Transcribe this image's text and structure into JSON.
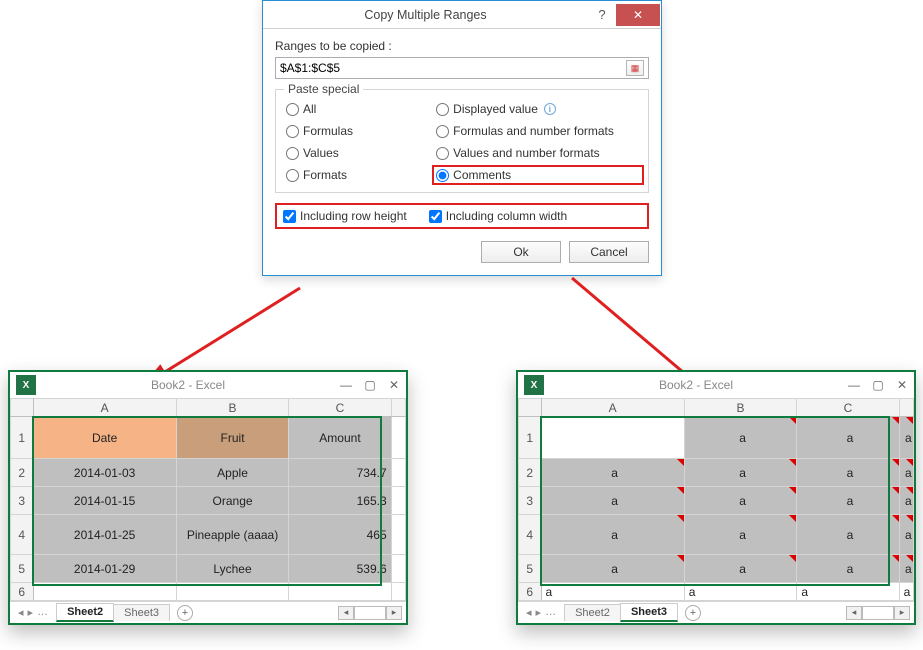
{
  "dialog": {
    "title": "Copy Multiple Ranges",
    "help_char": "?",
    "close_char": "✕",
    "ranges_label": "Ranges to be copied :",
    "ranges_value": "$A$1:$C$5",
    "fieldset_legend": "Paste special",
    "options": {
      "all": "All",
      "displayed_value": "Displayed value",
      "formulas": "Formulas",
      "formulas_num_fmt": "Formulas and number formats",
      "values": "Values",
      "values_num_fmt": "Values and number formats",
      "formats": "Formats",
      "comments": "Comments"
    },
    "selected_option": "comments",
    "checkboxes": {
      "row_height": "Including row height",
      "col_width": "Including column width",
      "row_height_checked": true,
      "col_width_checked": true
    },
    "ok_label": "Ok",
    "cancel_label": "Cancel"
  },
  "workbooks": {
    "left": {
      "title": "Book2 - Excel",
      "col_headers": [
        "A",
        "B",
        "C"
      ],
      "row_headers": [
        "1",
        "2",
        "3",
        "4",
        "5",
        "6"
      ],
      "header_row": [
        "Date",
        "Fruit",
        "Amount"
      ],
      "rows": [
        [
          "2014-01-03",
          "Apple",
          "734.7"
        ],
        [
          "2014-01-15",
          "Orange",
          "165.3"
        ],
        [
          "2014-01-25",
          "Pineapple (aaaa)",
          "465"
        ],
        [
          "2014-01-29",
          "Lychee",
          "539.6"
        ]
      ],
      "tabs": {
        "active": "Sheet2",
        "other": "Sheet3"
      }
    },
    "right": {
      "title": "Book2 - Excel",
      "col_headers": [
        "A",
        "B",
        "C",
        ""
      ],
      "row_headers": [
        "1",
        "2",
        "3",
        "4",
        "5",
        "6"
      ],
      "cells_value": "a",
      "tabs": {
        "active": "Sheet3",
        "other": "Sheet2"
      }
    }
  }
}
